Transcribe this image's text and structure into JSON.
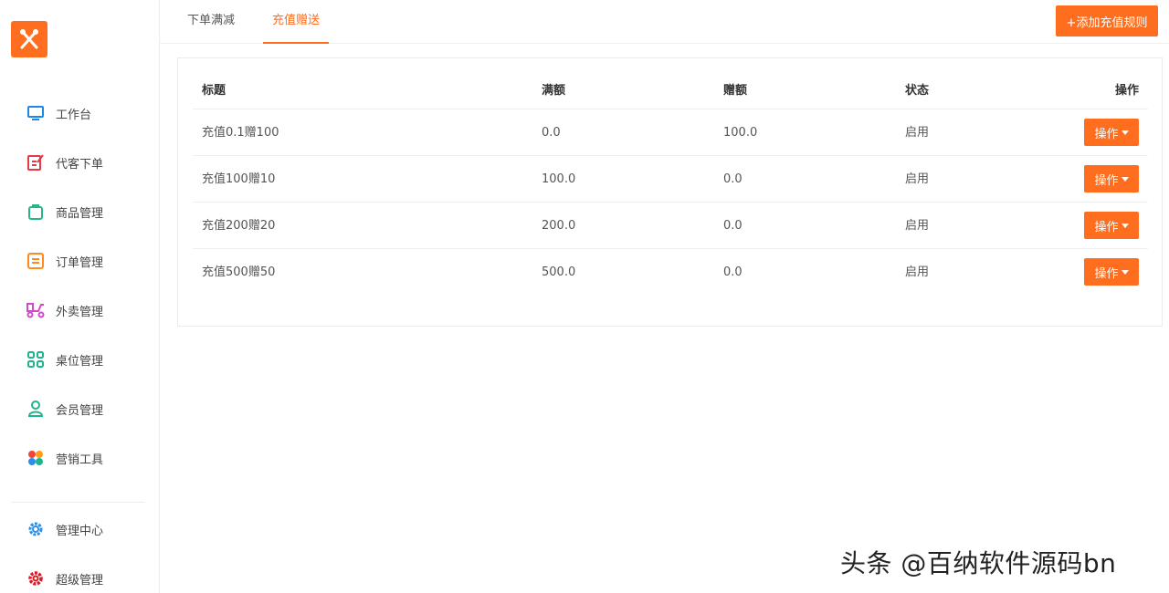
{
  "colors": {
    "accent": "#ff6d1f"
  },
  "sidebar": {
    "logo_icon": "fork-knife-icon",
    "items": [
      {
        "label": "工作台",
        "icon": "monitor-icon",
        "color": "#1e88e5"
      },
      {
        "label": "代客下单",
        "icon": "edit-order-icon",
        "color": "#e53945"
      },
      {
        "label": "商品管理",
        "icon": "bag-icon",
        "color": "#26b884"
      },
      {
        "label": "订单管理",
        "icon": "list-doc-icon",
        "color": "#ff8a1f"
      },
      {
        "label": "外卖管理",
        "icon": "scooter-icon",
        "color": "#d04ac9"
      },
      {
        "label": "桌位管理",
        "icon": "grid-icon",
        "color": "#1fb58c"
      },
      {
        "label": "会员管理",
        "icon": "user-icon",
        "color": "#1fb58c"
      },
      {
        "label": "营销工具",
        "icon": "flower-icon",
        "color": "#f0453a"
      }
    ],
    "bottom_items": [
      {
        "label": "管理中心",
        "icon": "gear-icon",
        "color": "#2e8fe6"
      },
      {
        "label": "超级管理",
        "icon": "gear-icon",
        "color": "#d81b23"
      }
    ]
  },
  "tabs": [
    {
      "label": "下单满减",
      "active": false
    },
    {
      "label": "充值赠送",
      "active": true
    }
  ],
  "add_button_label": "+添加充值规则",
  "table": {
    "headers": [
      "标题",
      "满额",
      "赠额",
      "状态",
      "操作"
    ],
    "rows": [
      {
        "title": "充值0.1赠100",
        "full": "0.0",
        "gift": "100.0",
        "status": "启用",
        "action": "操作"
      },
      {
        "title": "充值100赠10",
        "full": "100.0",
        "gift": "0.0",
        "status": "启用",
        "action": "操作"
      },
      {
        "title": "充值200赠20",
        "full": "200.0",
        "gift": "0.0",
        "status": "启用",
        "action": "操作"
      },
      {
        "title": "充值500赠50",
        "full": "500.0",
        "gift": "0.0",
        "status": "启用",
        "action": "操作"
      }
    ]
  },
  "watermark": "头条 @百纳软件源码bn"
}
